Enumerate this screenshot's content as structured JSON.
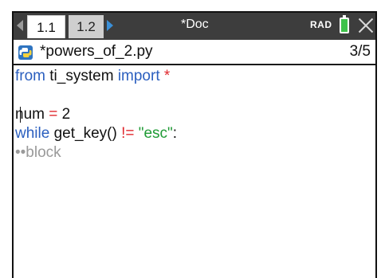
{
  "tabs": [
    {
      "label": "1.1",
      "active": true
    },
    {
      "label": "1.2",
      "active": false
    }
  ],
  "document": {
    "title": "*Doc"
  },
  "status": {
    "mode": "RAD"
  },
  "file": {
    "name": "*powers_of_2.py",
    "page": "3/5"
  },
  "code": {
    "line1": {
      "kw1": "from",
      "mod": " ti_system ",
      "kw2": "import",
      "star": " *"
    },
    "line3": {
      "var": "num ",
      "eq": "=",
      "val": " 2"
    },
    "line4": {
      "kw": "while",
      "call": " get_key() ",
      "neq": "!=",
      "str": " \"esc\"",
      "colon": ":"
    },
    "line5": {
      "placeholder": "••block"
    }
  },
  "colors": {
    "keyword": "#2b5fbf",
    "operator": "#e0282e",
    "string": "#1f9b35",
    "placeholder": "#9a9a9a",
    "titlebar": "#3d3d3d",
    "battery": "#3ec24a"
  },
  "icons": [
    "arrow-left-icon",
    "arrow-right-icon",
    "battery-icon",
    "close-icon",
    "python-file-icon"
  ]
}
